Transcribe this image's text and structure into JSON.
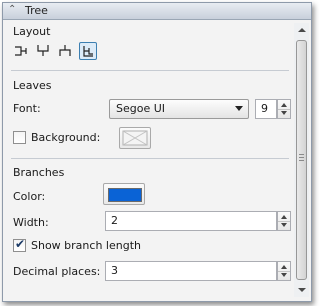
{
  "header": {
    "title": "Tree",
    "collapse_icon": "double-chevron-up-icon"
  },
  "layout": {
    "title": "Layout",
    "buttons": [
      {
        "name": "layout-rectangular",
        "icon": "tree-rectangular-icon",
        "selected": false
      },
      {
        "name": "layout-top-down",
        "icon": "tree-downward-icon",
        "selected": false
      },
      {
        "name": "layout-bottom-up",
        "icon": "tree-upward-icon",
        "selected": false
      },
      {
        "name": "layout-nested",
        "icon": "tree-nested-icon",
        "selected": true
      }
    ]
  },
  "leaves": {
    "title": "Leaves",
    "font_label": "Font:",
    "font_value": "Segoe UI",
    "font_size": "9",
    "background_label": "Background:",
    "background_checked": false
  },
  "branches": {
    "title": "Branches",
    "color_label": "Color:",
    "color_value": "#0a63d6",
    "width_label": "Width:",
    "width_value": "2",
    "show_length_label": "Show branch length",
    "show_length_checked": true,
    "decimal_label": "Decimal places:",
    "decimal_value": "3"
  }
}
